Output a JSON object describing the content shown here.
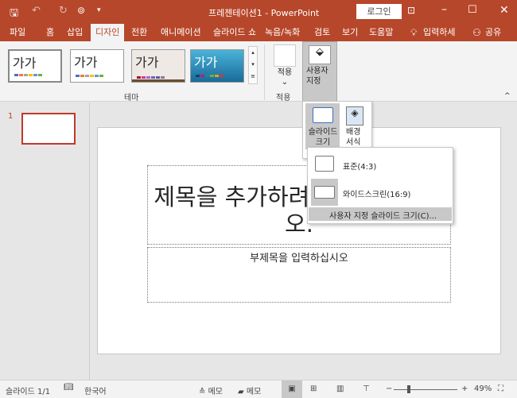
{
  "window": {
    "title": "프레젠테이션1  -  PowerPoint",
    "login": "로그인"
  },
  "tabs": [
    "파일",
    "홈",
    "삽입",
    "디자인",
    "전환",
    "애니메이션",
    "슬라이드 쇼",
    "녹음/녹화",
    "검토",
    "보기",
    "도움말",
    "입력하세",
    "공유"
  ],
  "ribbon": {
    "theme_label": "테마",
    "themes": [
      {
        "text": "가가"
      },
      {
        "text": "가가"
      },
      {
        "text": "가가"
      },
      {
        "text": "가가"
      }
    ],
    "apply_label": "적용",
    "apply_group": "적용",
    "customize_label": "사용자\n지정"
  },
  "size_panel": {
    "slide_size": "슬라이드\n크기",
    "bg_format": "배경\n서식"
  },
  "menu": {
    "items": [
      "표준(4:3)",
      "와이드스크린(16:9)",
      "사용자 지정 슬라이드 크기(C)..."
    ]
  },
  "thumbs": {
    "number": "1"
  },
  "slide": {
    "title": "제목을 추가하려면 클릭하십시오.",
    "subtitle": "부제목을 입력하십시오"
  },
  "status": {
    "slide_count": "슬라이드 1/1",
    "language": "한국어",
    "notes": "메모",
    "comments": "메모",
    "zoom": "49%",
    "zoom_value": 49
  }
}
